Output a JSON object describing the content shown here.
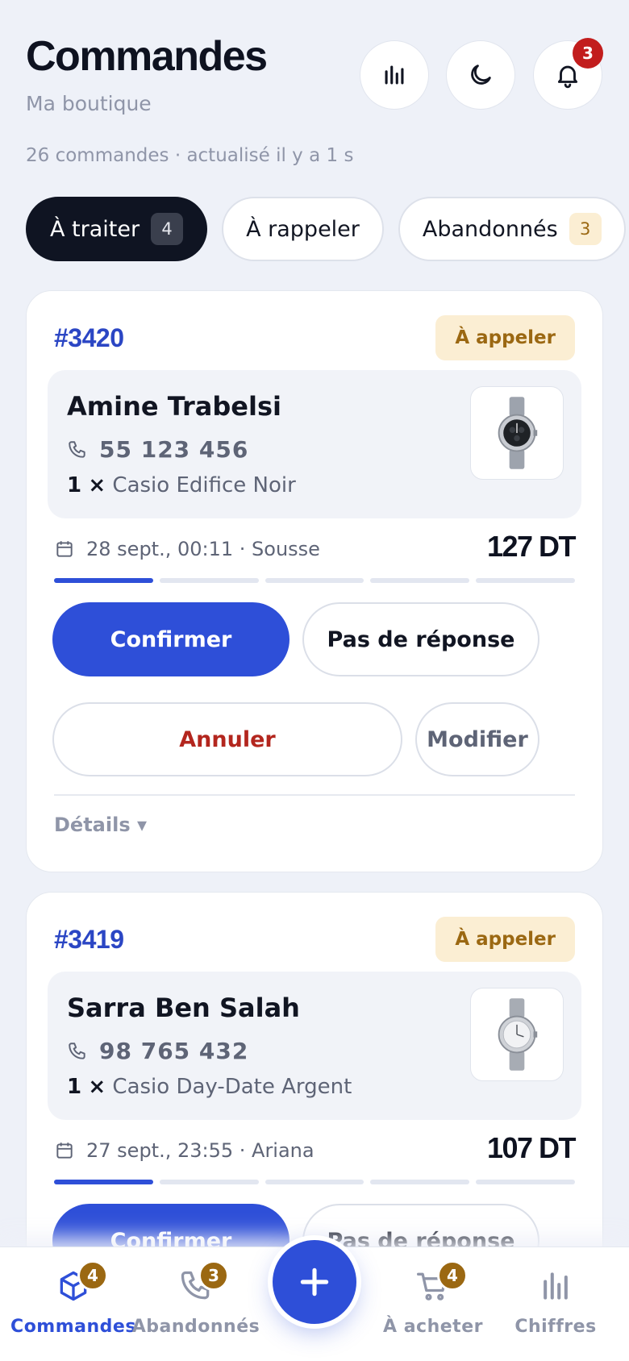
{
  "header": {
    "title": "Commandes",
    "shop_name": "Ma boutique",
    "meta": "26 commandes · actualisé il y a 1 s",
    "notification_count": "3"
  },
  "tabs": [
    {
      "label": "À traiter",
      "count": "4",
      "active": true
    },
    {
      "label": "À rappeler",
      "count": "",
      "active": false
    },
    {
      "label": "Abandonnés",
      "count": "3",
      "active": false
    }
  ],
  "orders": [
    {
      "number": "#3420",
      "status": "À appeler",
      "customer": "Amine Trabelsi",
      "phone": "55 123 456",
      "qty": "1",
      "times": "×",
      "product": "Casio Edifice Noir",
      "date_city": "28 sept., 00:11 · Sousse",
      "price": "127 DT",
      "progress_step": 1,
      "progress_total": 5,
      "actions": {
        "confirm": "Confirmer",
        "no_answer": "Pas de réponse",
        "cancel": "Annuler",
        "edit": "Modifier"
      },
      "details": "Détails ▾"
    },
    {
      "number": "#3419",
      "status": "À appeler",
      "customer": "Sarra Ben Salah",
      "phone": "98 765 432",
      "qty": "1",
      "times": "×",
      "product": "Casio Day-Date Argent",
      "date_city": "27 sept., 23:55 · Ariana",
      "price": "107 DT",
      "progress_step": 1,
      "progress_total": 5,
      "actions": {
        "confirm": "Confirmer",
        "no_answer": "Pas de réponse"
      }
    }
  ],
  "bottom_nav": [
    {
      "label": "Commandes",
      "badge": "4",
      "icon": "box-icon",
      "active": true
    },
    {
      "label": "Abandonnés",
      "badge": "3",
      "icon": "phone-icon",
      "active": false
    },
    {
      "label": "À acheter",
      "badge": "4",
      "icon": "cart-icon",
      "active": false
    },
    {
      "label": "Chiffres",
      "badge": "",
      "icon": "bar-chart-icon",
      "active": false
    }
  ],
  "colors": {
    "accent": "#2e4fd8",
    "dark": "#0f1422",
    "warning_bg": "#fbeed3",
    "warning_text": "#9b6812",
    "danger": "#b3261e",
    "background": "#eef1f8"
  }
}
